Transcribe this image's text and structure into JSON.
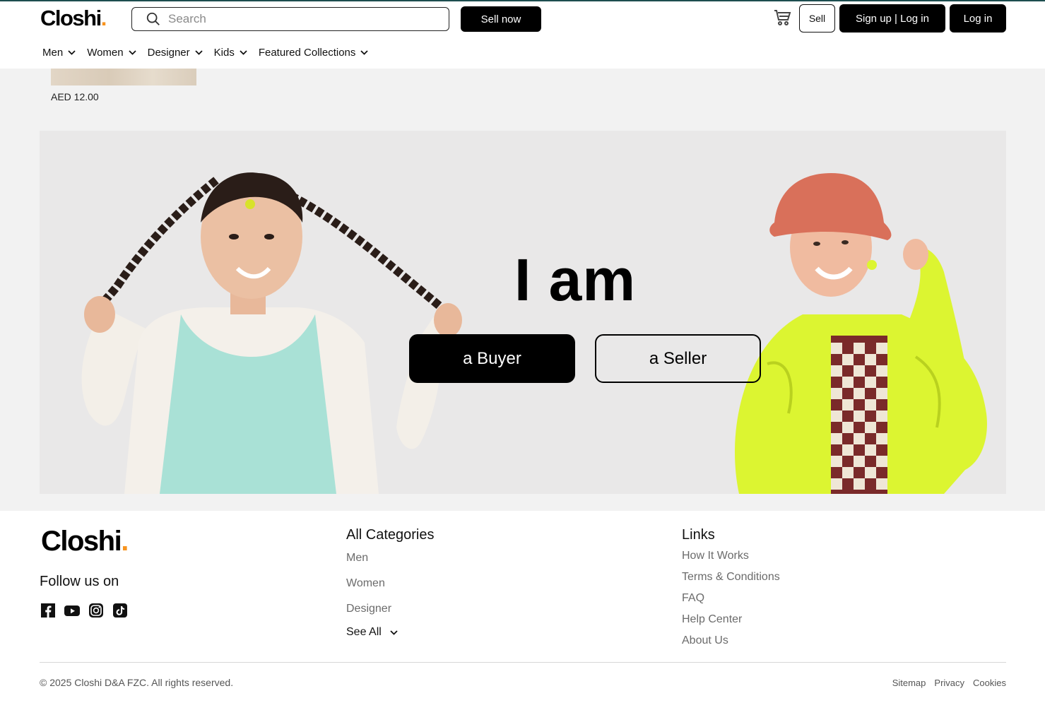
{
  "brand": {
    "name": "Closhi",
    "dot": ".",
    "accent": "#f7931e"
  },
  "header": {
    "search_placeholder": "Search",
    "sell_now": "Sell now",
    "sell": "Sell",
    "signup_login": "Sign up | Log in",
    "login": "Log in",
    "cart_icon": "cart-icon"
  },
  "nav": {
    "items": [
      {
        "label": "Men"
      },
      {
        "label": "Women"
      },
      {
        "label": "Designer"
      },
      {
        "label": "Kids"
      },
      {
        "label": "Featured Collections"
      }
    ]
  },
  "product": {
    "price": "AED 12.00"
  },
  "hero": {
    "title": "I am",
    "buyer": "a Buyer",
    "seller": "a Seller"
  },
  "footer": {
    "follow": "Follow us on",
    "socials": [
      "facebook-icon",
      "youtube-icon",
      "instagram-icon",
      "tiktok-icon"
    ],
    "categories": {
      "title": "All Categories",
      "items": [
        "Men",
        "Women",
        "Designer"
      ],
      "see_all": "See All"
    },
    "links": {
      "title": "Links",
      "items": [
        "How It Works",
        "Terms & Conditions",
        "FAQ",
        "Help Center",
        "About Us"
      ]
    },
    "copyright": "© 2025 Closhi D&A FZC. All rights reserved.",
    "legal": [
      "Sitemap",
      "Privacy",
      "Cookies"
    ]
  }
}
